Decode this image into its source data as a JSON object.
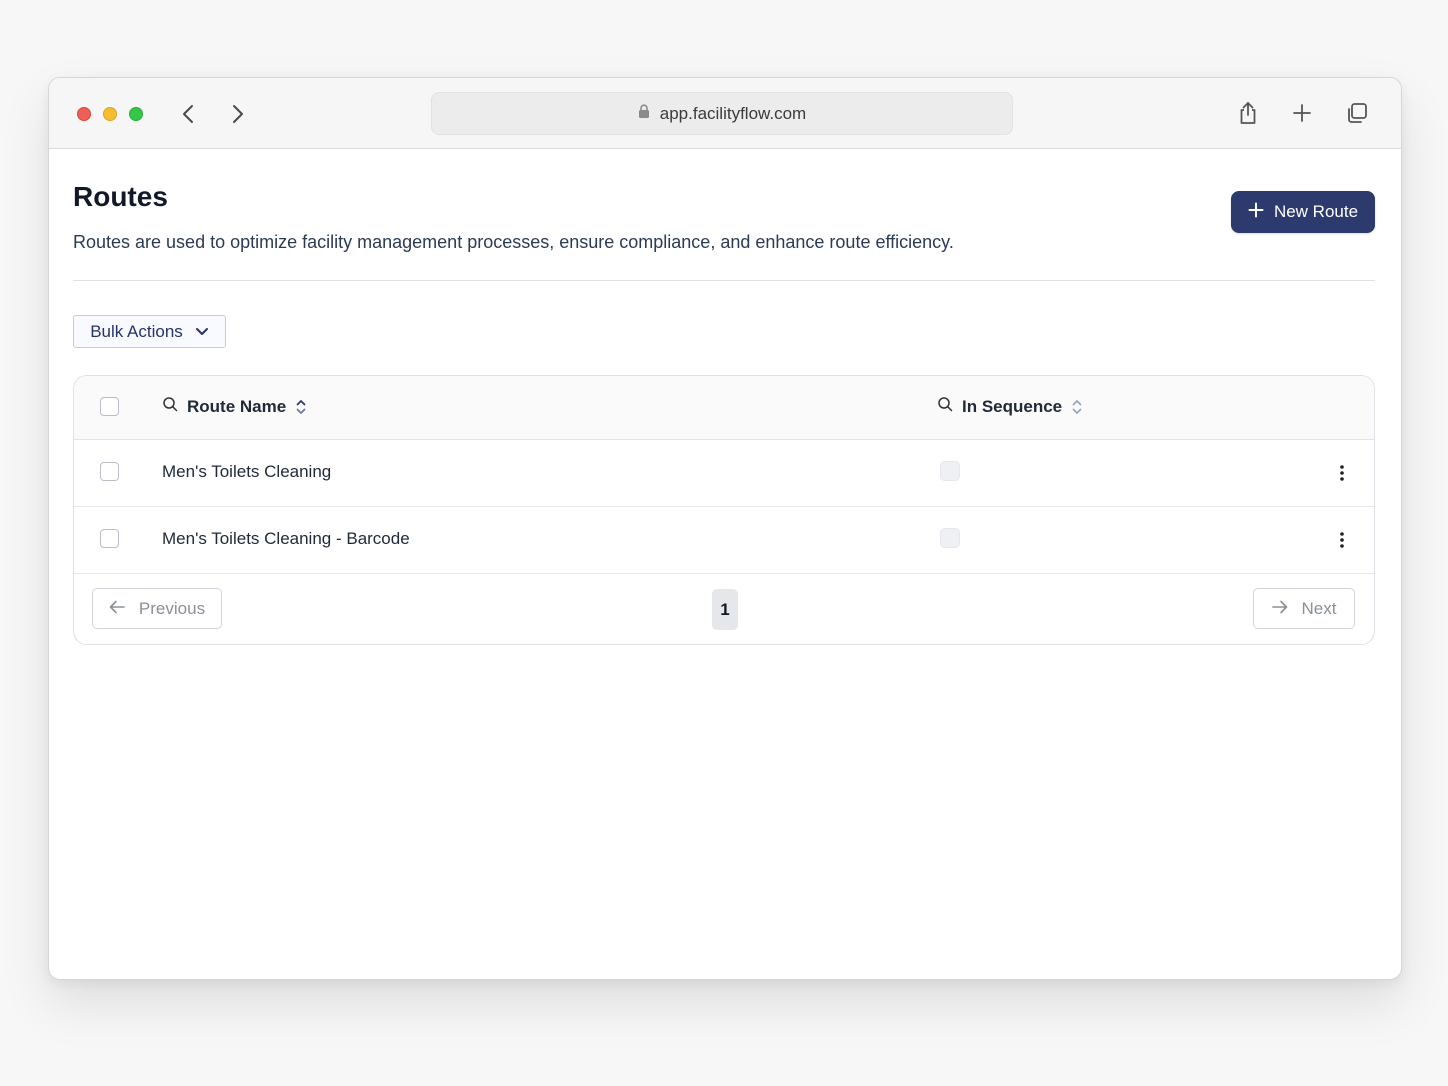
{
  "browser": {
    "url": "app.facilityflow.com"
  },
  "page": {
    "title": "Routes",
    "description": "Routes are used to optimize facility management processes, ensure compliance, and enhance route efficiency.",
    "new_button_label": "New Route"
  },
  "toolbar": {
    "bulk_actions_label": "Bulk Actions"
  },
  "table": {
    "columns": [
      {
        "label": "Route Name"
      },
      {
        "label": "In Sequence"
      }
    ],
    "rows": [
      {
        "name": "Men's Toilets Cleaning",
        "in_sequence": false
      },
      {
        "name": "Men's Toilets Cleaning - Barcode",
        "in_sequence": false
      }
    ]
  },
  "pagination": {
    "previous_label": "Previous",
    "next_label": "Next",
    "current_page": "1"
  },
  "colors": {
    "primary": "#2d3a6e",
    "border": "#dfe2e6"
  }
}
